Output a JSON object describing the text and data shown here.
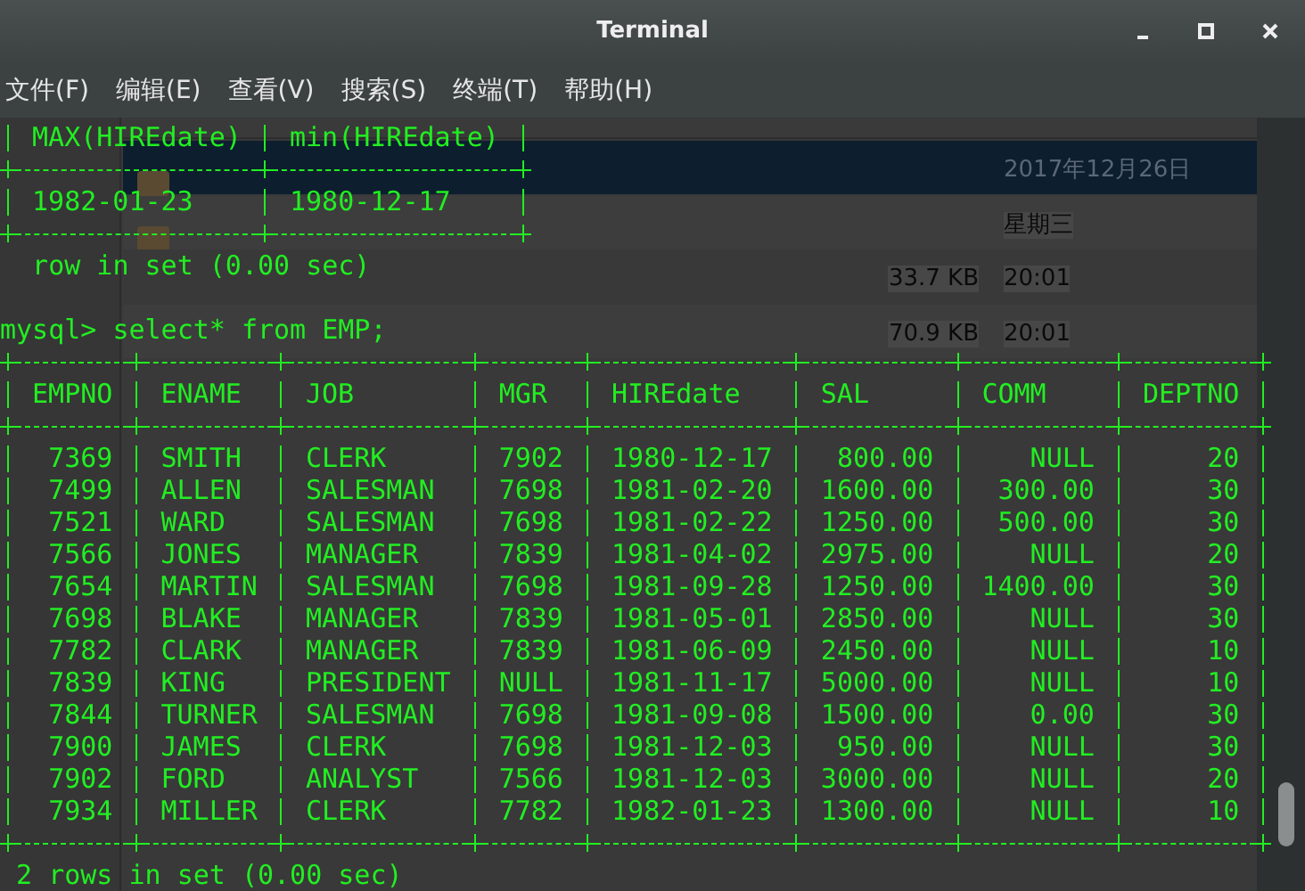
{
  "window": {
    "title": "Terminal"
  },
  "menu": [
    "文件(F)",
    "编辑(E)",
    "查看(V)",
    "搜索(S)",
    "终端(T)",
    "帮助(H)"
  ],
  "file_manager": {
    "rows": [
      {
        "kind": "folder",
        "modified": "2017年12月26日",
        "selected": true
      },
      {
        "kind": "folder",
        "modified": "星期三",
        "selected": false
      },
      {
        "kind": "file",
        "size": "33.7 KB",
        "modified": "20:01",
        "selected": false
      },
      {
        "kind": "file",
        "size": "70.9 KB",
        "modified": "20:01",
        "selected": false
      }
    ]
  },
  "terminal": {
    "blocks": [
      {
        "kind": "table",
        "top_border": false,
        "columns": [
          {
            "name": "MAX(HIREdate)",
            "numeric": false
          },
          {
            "name": "min(HIREdate)",
            "numeric": false
          }
        ],
        "rows": [
          [
            "1982-01-23",
            "1980-12-17"
          ]
        ]
      },
      {
        "kind": "text",
        "text": "row in set (0.00 sec)"
      },
      {
        "kind": "blank"
      },
      {
        "kind": "prompt",
        "prompt": "mysql>",
        "command": "select* from EMP;"
      },
      {
        "kind": "table",
        "top_border": true,
        "columns": [
          {
            "name": "EMPNO",
            "numeric": true
          },
          {
            "name": "ENAME",
            "numeric": false
          },
          {
            "name": "JOB",
            "numeric": false
          },
          {
            "name": "MGR",
            "numeric": false
          },
          {
            "name": "HIREdate",
            "numeric": false
          },
          {
            "name": "SAL",
            "numeric": true
          },
          {
            "name": "COMM",
            "numeric": true
          },
          {
            "name": "DEPTNO",
            "numeric": true
          }
        ],
        "rows": [
          [
            "7369",
            "SMITH",
            "CLERK",
            "7902",
            "1980-12-17",
            "800.00",
            "NULL",
            "20"
          ],
          [
            "7499",
            "ALLEN",
            "SALESMAN",
            "7698",
            "1981-02-20",
            "1600.00",
            "300.00",
            "30"
          ],
          [
            "7521",
            "WARD",
            "SALESMAN",
            "7698",
            "1981-02-22",
            "1250.00",
            "500.00",
            "30"
          ],
          [
            "7566",
            "JONES",
            "MANAGER",
            "7839",
            "1981-04-02",
            "2975.00",
            "NULL",
            "20"
          ],
          [
            "7654",
            "MARTIN",
            "SALESMAN",
            "7698",
            "1981-09-28",
            "1250.00",
            "1400.00",
            "30"
          ],
          [
            "7698",
            "BLAKE",
            "MANAGER",
            "7839",
            "1981-05-01",
            "2850.00",
            "NULL",
            "30"
          ],
          [
            "7782",
            "CLARK",
            "MANAGER",
            "7839",
            "1981-06-09",
            "2450.00",
            "NULL",
            "10"
          ],
          [
            "7839",
            "KING",
            "PRESIDENT",
            "NULL",
            "1981-11-17",
            "5000.00",
            "NULL",
            "10"
          ],
          [
            "7844",
            "TURNER",
            "SALESMAN",
            "7698",
            "1981-09-08",
            "1500.00",
            "0.00",
            "30"
          ],
          [
            "7900",
            "JAMES",
            "CLERK",
            "7698",
            "1981-12-03",
            "950.00",
            "NULL",
            "30"
          ],
          [
            "7902",
            "FORD",
            "ANALYST",
            "7566",
            "1981-12-03",
            "3000.00",
            "NULL",
            "20"
          ],
          [
            "7934",
            "MILLER",
            "CLERK",
            "7782",
            "1982-01-23",
            "1300.00",
            "NULL",
            "10"
          ]
        ]
      },
      {
        "kind": "text",
        "text": "2 rows in set (0.00 sec)"
      }
    ]
  }
}
